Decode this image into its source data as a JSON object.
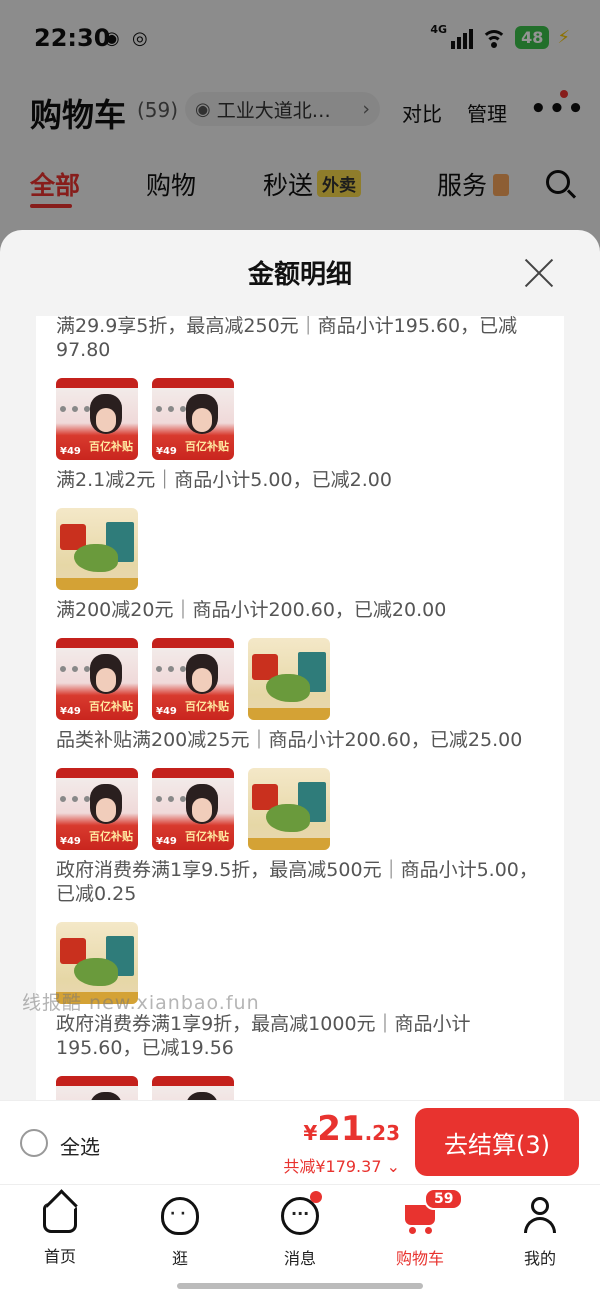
{
  "status": {
    "time": "22:30",
    "network": "4G",
    "battery": "48"
  },
  "header": {
    "title": "购物车",
    "count": "(59)",
    "address": "工业大道北…",
    "compare": "对比",
    "manage": "管理"
  },
  "tabs": {
    "all": "全部",
    "shopping": "购物",
    "express": "秒送",
    "takeout": "外卖",
    "service": "服务"
  },
  "sheet": {
    "title": "金额明细"
  },
  "groups": [
    {
      "text": "满29.9享5折，最高减250元｜商品小计195.60，已减97.80",
      "items": [
        "contact-lens",
        "contact-lens"
      ]
    },
    {
      "text": "满2.1减2元｜商品小计5.00，已减2.00",
      "items": [
        "bay-leaf"
      ]
    },
    {
      "text": "满200减20元｜商品小计200.60，已减20.00",
      "items": [
        "contact-lens",
        "contact-lens",
        "bay-leaf"
      ]
    },
    {
      "text": "品类补贴满200减25元｜商品小计200.60，已减25.00",
      "items": [
        "contact-lens",
        "contact-lens",
        "bay-leaf"
      ]
    },
    {
      "text": "政府消费券满1享9.5折，最高减500元｜商品小计5.00，已减0.25",
      "items": [
        "bay-leaf"
      ]
    },
    {
      "text": "政府消费券满1享9折，最高减1000元｜商品小计195.60，已减19.56",
      "items": [
        "contact-lens",
        "contact-lens"
      ]
    }
  ],
  "product_text": {
    "contact_price": "¥49",
    "contact_tag": "百亿补贴"
  },
  "watermark": "线报酷 new.xianbao.fun",
  "checkout": {
    "select_all": "全选",
    "currency": "¥",
    "price_int": "21",
    "price_dec": ".23",
    "saved": "共减¥179.37 ⌄",
    "button": "去结算(3)"
  },
  "tabbar": {
    "home": "首页",
    "browse": "逛",
    "messages": "消息",
    "cart": "购物车",
    "cart_badge": "59",
    "me": "我的"
  },
  "colors": {
    "accent": "#e8332f",
    "sheet_bg": "#f3f3f3"
  }
}
